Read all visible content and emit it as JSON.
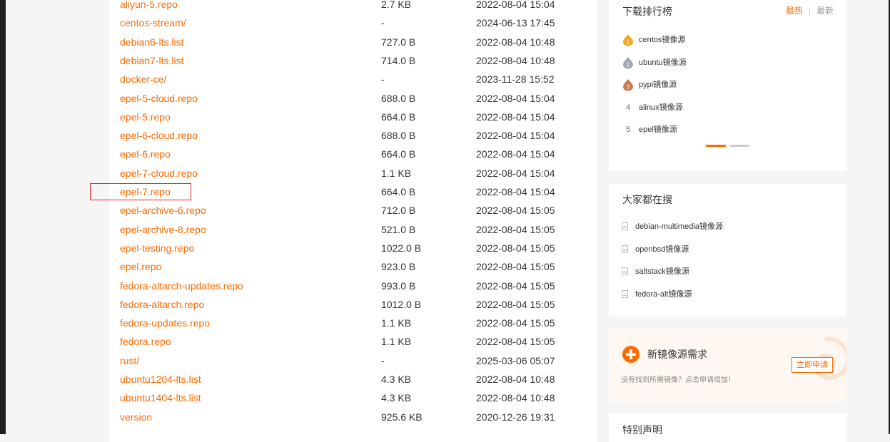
{
  "file_list": {
    "rows": [
      {
        "name": "aliyun-5.repo",
        "size": "2.7 KB",
        "date": "2022-08-04 15:04"
      },
      {
        "name": "centos-stream/",
        "size": "-",
        "date": "2024-06-13 17:45"
      },
      {
        "name": "debian6-lts.list",
        "size": "727.0 B",
        "date": "2022-08-04 10:48"
      },
      {
        "name": "debian7-lts.list",
        "size": "714.0 B",
        "date": "2022-08-04 10:48"
      },
      {
        "name": "docker-ce/",
        "size": "-",
        "date": "2023-11-28 15:52"
      },
      {
        "name": "epel-5-cloud.repo",
        "size": "688.0 B",
        "date": "2022-08-04 15:04"
      },
      {
        "name": "epel-5.repo",
        "size": "664.0 B",
        "date": "2022-08-04 15:04"
      },
      {
        "name": "epel-6-cloud.repo",
        "size": "688.0 B",
        "date": "2022-08-04 15:04"
      },
      {
        "name": "epel-6.repo",
        "size": "664.0 B",
        "date": "2022-08-04 15:04"
      },
      {
        "name": "epel-7-cloud.repo",
        "size": "1.1 KB",
        "date": "2022-08-04 15:04"
      },
      {
        "name": "epel-7.repo",
        "size": "664.0 B",
        "date": "2022-08-04 15:04"
      },
      {
        "name": "epel-archive-6.repo",
        "size": "712.0 B",
        "date": "2022-08-04 15:05"
      },
      {
        "name": "epel-archive-8.repo",
        "size": "521.0 B",
        "date": "2022-08-04 15:05"
      },
      {
        "name": "epel-testing.repo",
        "size": "1022.0 B",
        "date": "2022-08-04 15:05"
      },
      {
        "name": "epel.repo",
        "size": "923.0 B",
        "date": "2022-08-04 15:05"
      },
      {
        "name": "fedora-altarch-updates.repo",
        "size": "993.0 B",
        "date": "2022-08-04 15:05"
      },
      {
        "name": "fedora-altarch.repo",
        "size": "1012.0 B",
        "date": "2022-08-04 15:05"
      },
      {
        "name": "fedora-updates.repo",
        "size": "1.1 KB",
        "date": "2022-08-04 15:05"
      },
      {
        "name": "fedora.repo",
        "size": "1.1 KB",
        "date": "2022-08-04 15:05"
      },
      {
        "name": "rust/",
        "size": "-",
        "date": "2025-03-06 05:07"
      },
      {
        "name": "ubuntu1204-lts.list",
        "size": "4.3 KB",
        "date": "2022-08-04 10:48"
      },
      {
        "name": "ubuntu1404-lts.list",
        "size": "4.3 KB",
        "date": "2022-08-04 10:48"
      },
      {
        "name": "version",
        "size": "925.6 KB",
        "date": "2020-12-26 19:31"
      }
    ],
    "highlighted": "epel-7.repo"
  },
  "ranking": {
    "title": "下载排行榜",
    "tab_hot": "最热",
    "tab_new": "最新",
    "items": [
      {
        "rank": "1",
        "label": "centos镜像源",
        "badge_color": "#f5a623"
      },
      {
        "rank": "2",
        "label": "ubuntu镜像源",
        "badge_color": "#9ea7b3"
      },
      {
        "rank": "3",
        "label": "pypi镜像源",
        "badge_color": "#c8794a"
      },
      {
        "rank": "4",
        "label": "alinux镜像源"
      },
      {
        "rank": "5",
        "label": "epel镜像源"
      }
    ]
  },
  "popular_searches": {
    "title": "大家都在搜",
    "items": [
      "debian-multimedia镜像源",
      "openbsd镜像源",
      "saltstack镜像源",
      "fedora-alt镜像源"
    ]
  },
  "new_request": {
    "title": "新镜像源需求",
    "description": "没有找到所需镜像？点击申请增加！",
    "button": "立即申请"
  },
  "notice": {
    "title": "特别声明"
  },
  "colors": {
    "accent": "#ff6a00",
    "highlight_border": "#e02020"
  }
}
